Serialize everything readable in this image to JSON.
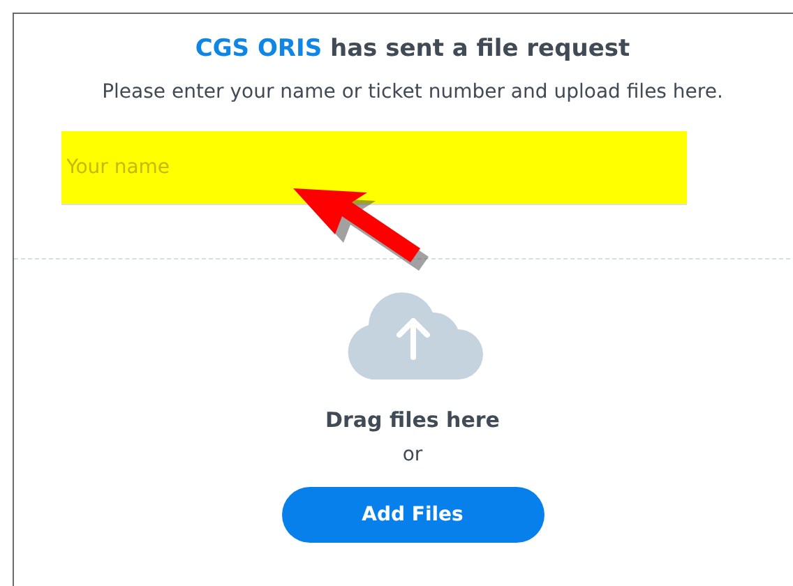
{
  "title": {
    "sender": "CGS ORIS",
    "text": "has sent a file request"
  },
  "instructions": "Please enter your name or ticket number and upload files here.",
  "name_field": {
    "placeholder": "Your name",
    "highlighted": true
  },
  "drop_zone": {
    "label": "Drag files here",
    "separator": "or",
    "button": "Add Files"
  }
}
